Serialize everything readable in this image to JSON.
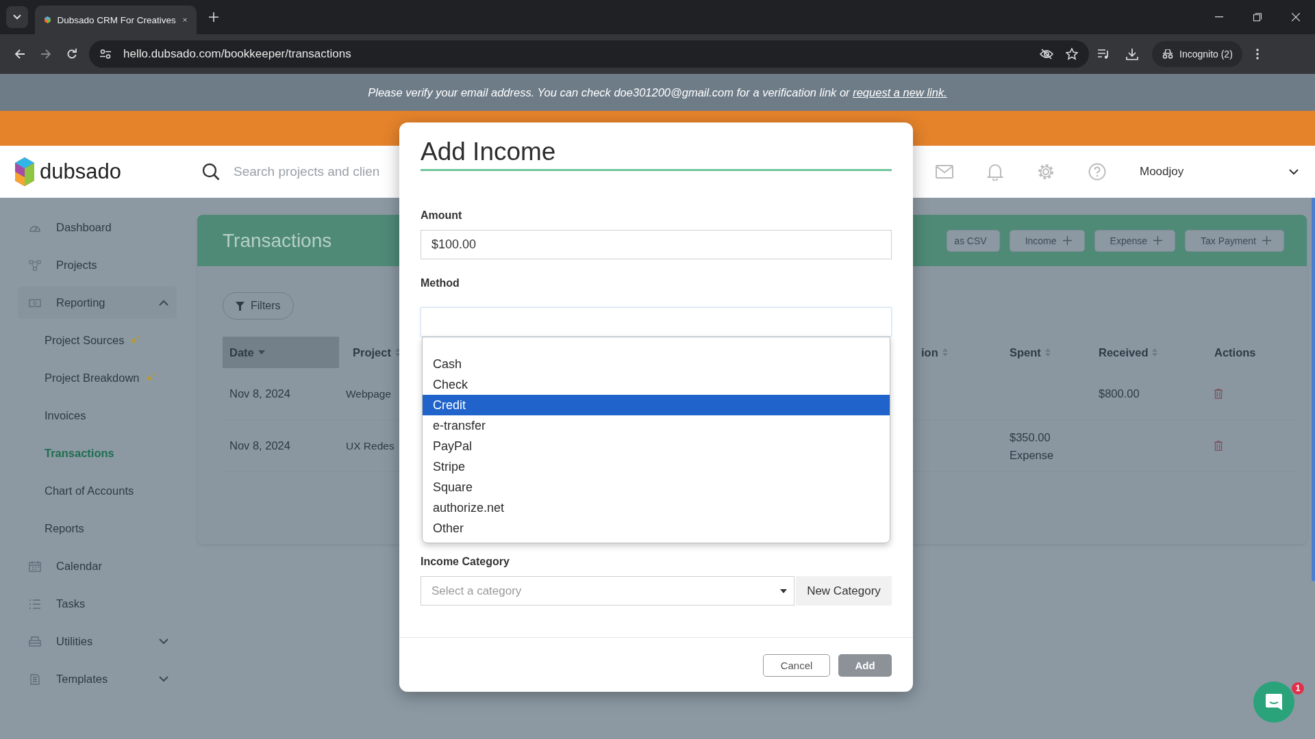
{
  "browser": {
    "tabs": [
      {
        "title": "Dubsado CRM For Creatives",
        "selected": true
      }
    ],
    "url": "hello.dubsado.com/bookkeeper/transactions",
    "profile": "Incognito (2)"
  },
  "notice": {
    "text": "Please verify your email address. You can check doe301200@gmail.com for a verification link or",
    "link": "request a new link."
  },
  "header": {
    "logo": "dubsado",
    "search_placeholder": "Search projects and clien",
    "user": "Moodjoy"
  },
  "sidebar": {
    "items": [
      {
        "label": "Dashboard",
        "selected": false
      },
      {
        "label": "Projects",
        "selected": false
      },
      {
        "label": "Reporting",
        "selected": false,
        "expanded": true,
        "children": [
          {
            "label": "Project Sources",
            "selected": false,
            "new": true
          },
          {
            "label": "Project Breakdown",
            "selected": false,
            "new": true
          },
          {
            "label": "Invoices",
            "selected": false,
            "new": false
          },
          {
            "label": "Transactions",
            "selected": true,
            "new": false
          },
          {
            "label": "Chart of Accounts",
            "selected": false,
            "new": false
          },
          {
            "label": "Reports",
            "selected": false,
            "new": false
          }
        ]
      },
      {
        "label": "Calendar",
        "selected": false
      },
      {
        "label": "Tasks",
        "selected": false
      },
      {
        "label": "Utilities",
        "selected": false,
        "expanded": false
      },
      {
        "label": "Templates",
        "selected": false,
        "expanded": false
      }
    ]
  },
  "page": {
    "title": "Transactions",
    "actions": [
      {
        "label": "as CSV",
        "plus": false
      },
      {
        "label": "Income",
        "plus": true
      },
      {
        "label": "Expense",
        "plus": true
      },
      {
        "label": "Tax Payment",
        "plus": true
      }
    ],
    "filters": "Filters",
    "table": {
      "columns": [
        {
          "label": "Date",
          "sortable": true,
          "sorted": true
        },
        {
          "label": "Project",
          "sortable": true,
          "sorted": false
        },
        {
          "label": "ion",
          "sortable": true,
          "sorted": false
        },
        {
          "label": "Spent",
          "sortable": true,
          "sorted": false
        },
        {
          "label": "Received",
          "sortable": true,
          "sorted": false
        },
        {
          "label": "Actions",
          "sortable": false,
          "sorted": false
        }
      ],
      "rows": [
        {
          "date": "Nov 8, 2024",
          "project": "Webpage",
          "received": "$800.00"
        },
        {
          "date": "Nov 8, 2024",
          "project": "UX Redes",
          "spent": "$350.00",
          "spent_type": "Expense"
        }
      ]
    }
  },
  "dialog": {
    "title": "Add Income",
    "amount": {
      "label": "Amount",
      "value": "$100.00"
    },
    "method": {
      "label": "Method",
      "options": [
        {
          "label": "Cash",
          "selected": false
        },
        {
          "label": "Check",
          "selected": false
        },
        {
          "label": "Credit",
          "selected": true
        },
        {
          "label": "e-transfer",
          "selected": false
        },
        {
          "label": "PayPal",
          "selected": false
        },
        {
          "label": "Stripe",
          "selected": false
        },
        {
          "label": "Square",
          "selected": false
        },
        {
          "label": "authorize.net",
          "selected": false
        },
        {
          "label": "Other",
          "selected": false
        }
      ]
    },
    "category": {
      "label": "Income Category",
      "placeholder": "Select a category",
      "new_button": "New Category"
    },
    "buttons": [
      {
        "label": "Cancel",
        "kind": "secondary"
      },
      {
        "label": "Add",
        "kind": "primary"
      }
    ]
  },
  "chat": {
    "badge": "1"
  }
}
